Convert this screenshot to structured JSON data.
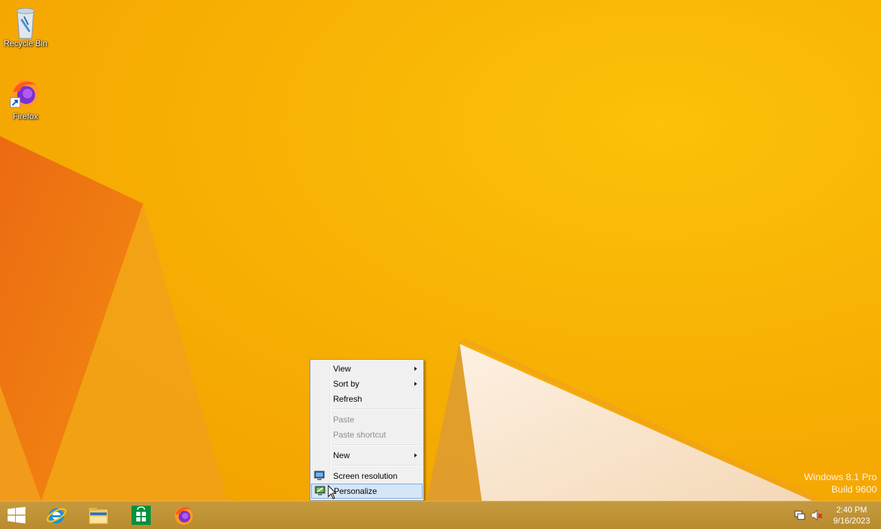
{
  "desktop": {
    "icons": [
      {
        "label": "Recycle Bin",
        "icon": "recycle-bin-icon"
      },
      {
        "label": "Firefox",
        "icon": "firefox-icon"
      }
    ],
    "watermark": {
      "line1": "Windows 8.1 Pro",
      "line2": "Build 9600"
    }
  },
  "context_menu": {
    "items": [
      {
        "label": "View",
        "submenu": true
      },
      {
        "label": "Sort by",
        "submenu": true
      },
      {
        "label": "Refresh"
      },
      {
        "label": "Paste",
        "disabled": true
      },
      {
        "label": "Paste shortcut",
        "disabled": true
      },
      {
        "label": "New",
        "submenu": true
      },
      {
        "label": "Screen resolution",
        "icon": "monitor-icon"
      },
      {
        "label": "Personalize",
        "icon": "personalize-icon",
        "highlighted": true
      }
    ]
  },
  "taskbar": {
    "pinned": [
      {
        "icon": "start-windows-icon"
      },
      {
        "icon": "internet-explorer-icon"
      },
      {
        "icon": "file-explorer-icon"
      },
      {
        "icon": "windows-store-icon"
      },
      {
        "icon": "firefox-icon"
      }
    ],
    "tray": [
      {
        "icon": "network-icon"
      },
      {
        "icon": "volume-muted-icon"
      }
    ],
    "clock": {
      "time": "2:40 PM",
      "date": "9/16/2023"
    }
  },
  "colors": {
    "wallpaper_main": "#f7b200",
    "wallpaper_orange": "#ee7a10",
    "taskbar": "#bf9236",
    "menu_highlight": "#d5e6f7"
  }
}
